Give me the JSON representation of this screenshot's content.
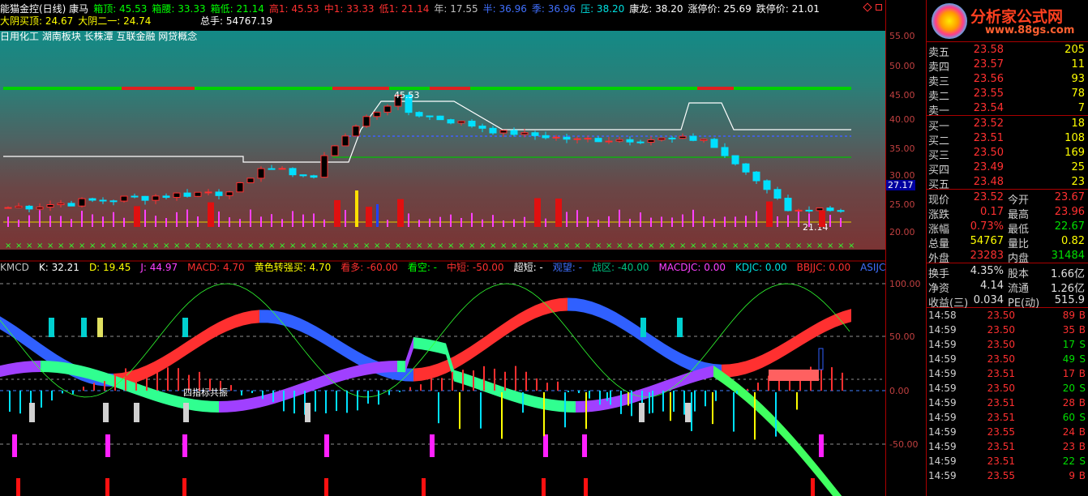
{
  "header": {
    "title": "能猫金控(日线) 康马",
    "items": [
      {
        "t": "箱顶: 45.53",
        "c": "#00ff00"
      },
      {
        "t": "箱腰: 33.33",
        "c": "#00ff00"
      },
      {
        "t": "箱低: 21.14",
        "c": "#00ff00"
      },
      {
        "t": "高1: 45.53",
        "c": "#ff3030"
      },
      {
        "t": "中1: 33.33",
        "c": "#ff3030"
      },
      {
        "t": "低1: 21.14",
        "c": "#ff3030"
      },
      {
        "t": "年: 17.55",
        "c": "#c0c0c0"
      },
      {
        "t": "半: 36.96",
        "c": "#4070ff"
      },
      {
        "t": "季: 36.96",
        "c": "#4070ff"
      },
      {
        "t": "压: 38.20",
        "c": "#00e0e0"
      },
      {
        "t": "康龙: 38.20",
        "c": "#ffffff"
      },
      {
        "t": "涨停价: 25.69",
        "c": "#ffffff"
      },
      {
        "t": "跌停价: 21.01",
        "c": "#ffffff"
      }
    ],
    "line2": [
      {
        "t": "大阴买顶: 24.67",
        "c": "#ffff00"
      },
      {
        "t": "大阴二一: 24.74",
        "c": "#ffff00"
      }
    ],
    "line2b": {
      "t": "总手: 54767.19",
      "c": "#ffffff"
    },
    "plates": "日用化工  湖南板块  长株潭  互联金融  网贷概念"
  },
  "kline_labels": {
    "high": "45.53",
    "low": "21.14"
  },
  "price_axis": [
    "55.00",
    "50.00",
    "45.00",
    "40.00",
    "35.00",
    "30.00",
    "27.17",
    "25.00",
    "20.00"
  ],
  "ind_axis": [
    "100.00",
    "50.00",
    "0.00",
    "-50.00"
  ],
  "indicator": {
    "items": [
      {
        "t": "KMCD",
        "c": "#c0c0c0"
      },
      {
        "t": "K: 32.21",
        "c": "#ffffff"
      },
      {
        "t": "D: 19.45",
        "c": "#ffff00"
      },
      {
        "t": "J: 44.97",
        "c": "#ff40ff"
      },
      {
        "t": "MACD: 4.70",
        "c": "#ff3030"
      },
      {
        "t": "黄色转强买: 4.70",
        "c": "#ffff00"
      },
      {
        "t": "看多: -60.00",
        "c": "#ff3030"
      },
      {
        "t": "看空: -",
        "c": "#00ff00"
      },
      {
        "t": "中短: -50.00",
        "c": "#ff3030"
      },
      {
        "t": "超短: -",
        "c": "#ffffff"
      },
      {
        "t": "观望: -",
        "c": "#4070ff"
      },
      {
        "t": "战区: -40.00",
        "c": "#00c080"
      },
      {
        "t": "MACDJC: 0.00",
        "c": "#ff40ff"
      },
      {
        "t": "KDJC: 0.00",
        "c": "#00e0e0"
      },
      {
        "t": "BBJJC: 0.00",
        "c": "#ff3030"
      },
      {
        "t": "ASIJC",
        "c": "#4070ff"
      }
    ],
    "note": "四指标共振"
  },
  "quote": {
    "sell": [
      {
        "l": "卖五",
        "p": "23.58",
        "v": "205"
      },
      {
        "l": "卖四",
        "p": "23.57",
        "v": "11"
      },
      {
        "l": "卖三",
        "p": "23.56",
        "v": "93"
      },
      {
        "l": "卖二",
        "p": "23.55",
        "v": "78"
      },
      {
        "l": "卖一",
        "p": "23.54",
        "v": "7"
      }
    ],
    "buy": [
      {
        "l": "买一",
        "p": "23.52",
        "v": "18"
      },
      {
        "l": "买二",
        "p": "23.51",
        "v": "108"
      },
      {
        "l": "买三",
        "p": "23.50",
        "v": "169"
      },
      {
        "l": "买四",
        "p": "23.49",
        "v": "25"
      },
      {
        "l": "买五",
        "p": "23.48",
        "v": "23"
      }
    ],
    "stats": [
      {
        "l": "现价",
        "v": "23.52",
        "c": "red",
        "l2": "今开",
        "v2": "23.67",
        "c2": "red"
      },
      {
        "l": "涨跌",
        "v": "0.17",
        "c": "red",
        "l2": "最高",
        "v2": "23.96",
        "c2": "red"
      },
      {
        "l": "涨幅",
        "v": "0.73%",
        "c": "red",
        "l2": "最低",
        "v2": "22.67",
        "c2": "grn"
      },
      {
        "l": "总量",
        "v": "54767",
        "c": "yel",
        "l2": "量比",
        "v2": "0.82",
        "c2": "yel"
      },
      {
        "l": "外盘",
        "v": "23283",
        "c": "red",
        "l2": "内盘",
        "v2": "31484",
        "c2": "grn"
      }
    ],
    "stats2": [
      {
        "l": "换手",
        "v": "4.35%",
        "c": "wht",
        "l2": "股本",
        "v2": "1.66亿",
        "c2": "wht"
      },
      {
        "l": "净资",
        "v": "4.14",
        "c": "wht",
        "l2": "流通",
        "v2": "1.26亿",
        "c2": "wht"
      },
      {
        "l": "收益(三)",
        "v": "0.034",
        "c": "wht",
        "l2": "PE(动)",
        "v2": "515.9",
        "c2": "wht"
      }
    ],
    "ticks": [
      {
        "t": "14:58",
        "p": "23.50",
        "v": "89",
        "s": "B"
      },
      {
        "t": "14:59",
        "p": "23.50",
        "v": "35",
        "s": "B"
      },
      {
        "t": "14:59",
        "p": "23.50",
        "v": "17",
        "s": "S"
      },
      {
        "t": "14:59",
        "p": "23.50",
        "v": "49",
        "s": "S"
      },
      {
        "t": "14:59",
        "p": "23.51",
        "v": "17",
        "s": "B"
      },
      {
        "t": "14:59",
        "p": "23.50",
        "v": "20",
        "s": "S"
      },
      {
        "t": "14:59",
        "p": "23.51",
        "v": "28",
        "s": "B"
      },
      {
        "t": "14:59",
        "p": "23.51",
        "v": "60",
        "s": "S"
      },
      {
        "t": "14:59",
        "p": "23.55",
        "v": "24",
        "s": "B"
      },
      {
        "t": "14:59",
        "p": "23.51",
        "v": "23",
        "s": "B"
      },
      {
        "t": "14:59",
        "p": "23.51",
        "v": "22",
        "s": "S"
      },
      {
        "t": "14:59",
        "p": "23.55",
        "v": "9",
        "s": "B"
      }
    ]
  },
  "logo": {
    "name": "分析家公式网",
    "url": "www.88gs.com"
  },
  "colors": {
    "up": "#ff3030",
    "down": "#00e0ff",
    "buy": "#ff3030",
    "sell": "#00e000"
  }
}
